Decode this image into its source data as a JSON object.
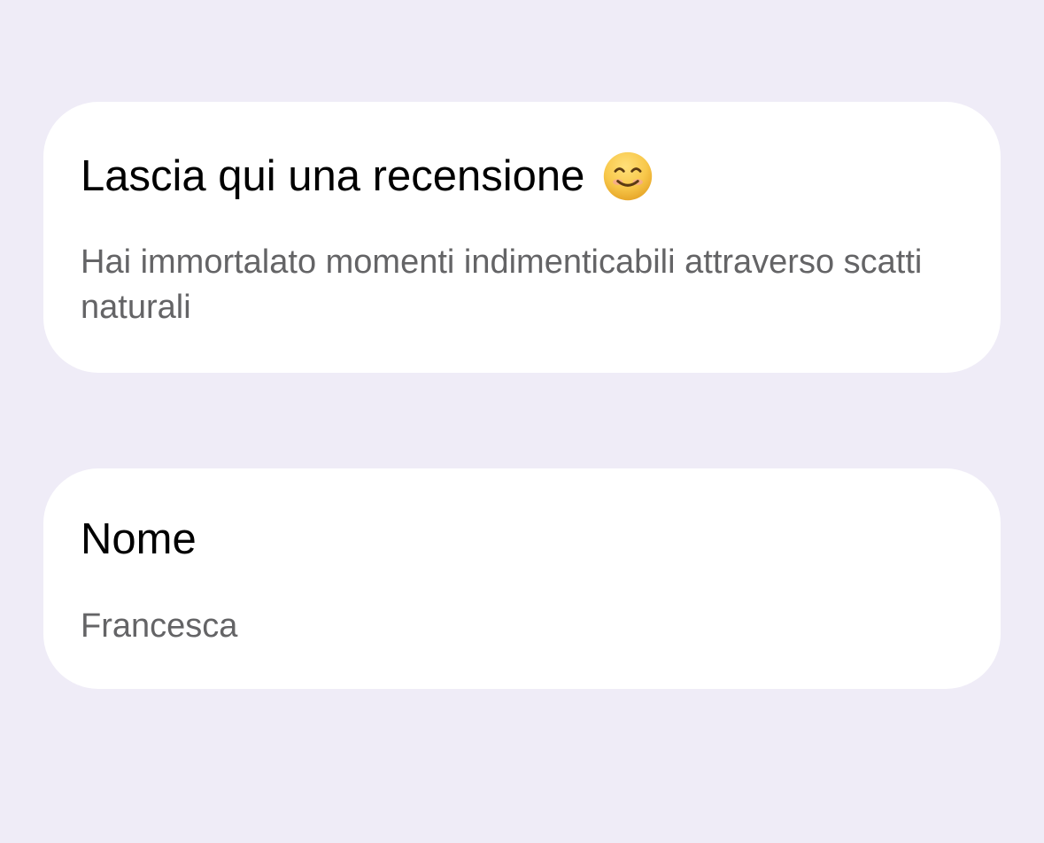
{
  "page": {
    "background_color": "#EFECF7"
  },
  "review_card": {
    "title": "Lascia qui una recensione",
    "emoji_icon": "smiling-face-with-smiling-eyes-icon",
    "description": "Hai immortalato momenti indimenticabili attraverso scatti naturali"
  },
  "name_card": {
    "label": "Nome",
    "value": "Francesca"
  },
  "colors": {
    "card_background": "#FFFFFF",
    "title_text": "#000000",
    "secondary_text": "#646466",
    "emoji_face": "#F7C84A"
  }
}
